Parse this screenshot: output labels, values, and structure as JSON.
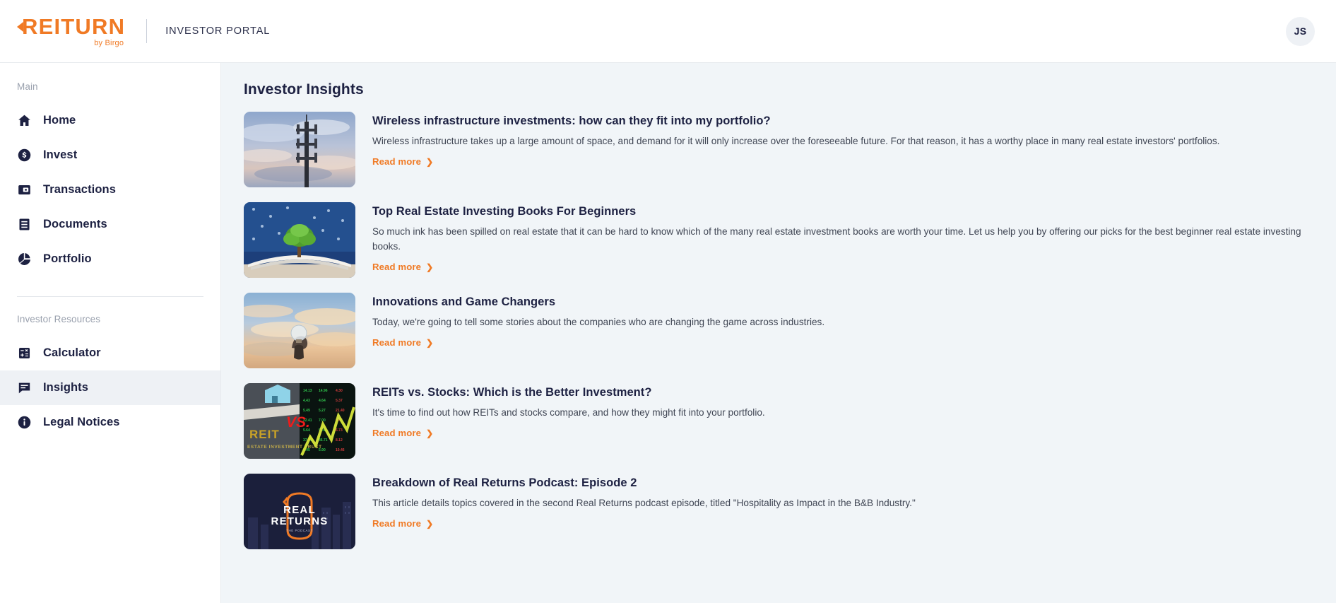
{
  "header": {
    "logo_text": "REITURN",
    "logo_subtext": "by Birgo",
    "portal_label": "INVESTOR PORTAL",
    "avatar_initials": "JS",
    "brand_color": "#F07A25"
  },
  "sidebar": {
    "groups": [
      {
        "label": "Main",
        "items": [
          {
            "label": "Home",
            "icon": "home-icon",
            "active": false
          },
          {
            "label": "Invest",
            "icon": "dollar-circle-icon",
            "active": false
          },
          {
            "label": "Transactions",
            "icon": "transactions-icon",
            "active": false
          },
          {
            "label": "Documents",
            "icon": "documents-icon",
            "active": false
          },
          {
            "label": "Portfolio",
            "icon": "pie-chart-icon",
            "active": false
          }
        ]
      },
      {
        "label": "Investor Resources",
        "items": [
          {
            "label": "Calculator",
            "icon": "calculator-icon",
            "active": false
          },
          {
            "label": "Insights",
            "icon": "chat-icon",
            "active": true
          },
          {
            "label": "Legal Notices",
            "icon": "info-circle-icon",
            "active": false
          }
        ]
      }
    ]
  },
  "main": {
    "page_title": "Investor Insights",
    "read_more_label": "Read more",
    "read_more_chevron": "❯",
    "articles": [
      {
        "title": "Wireless infrastructure investments: how can they fit into my portfolio?",
        "description": "Wireless infrastructure takes up a large amount of space, and demand for it will only increase over the foreseeable future. For that reason, it has a worthy place in many real estate investors' portfolios.",
        "thumbnail": "cell-tower-at-sunset"
      },
      {
        "title": "Top Real Estate Investing Books For Beginners",
        "description": "So much ink has been spilled on real estate that it can be hard to know which of the many real estate investment books are worth your time. Let us help you by offering our picks for the best beginner real estate investing books.",
        "thumbnail": "tree-growing-from-open-book"
      },
      {
        "title": "Innovations and Game Changers",
        "description": "Today, we're going to tell some stories about the companies who are changing the game across industries.",
        "thumbnail": "hand-holding-lightbulb-at-sunset"
      },
      {
        "title": "REITs vs. Stocks: Which is the Better Investment?",
        "description": "It's time to find out how REITs and stocks compare, and how they might fit into your portfolio.",
        "thumbnail": "reit-versus-stocks-split-image"
      },
      {
        "title": "Breakdown of Real Returns Podcast: Episode 2",
        "description": "This article details topics covered in the second Real Returns podcast episode, titled \"Hospitality as Impact in the B&B Industry.\"",
        "thumbnail": "real-returns-podcast-cover"
      }
    ]
  }
}
